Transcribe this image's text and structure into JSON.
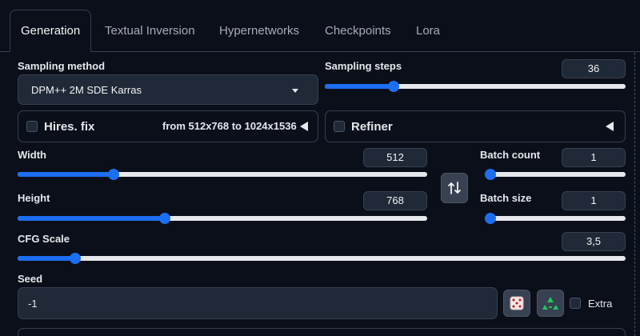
{
  "tabs": [
    {
      "label": "Generation",
      "active": true
    },
    {
      "label": "Textual Inversion",
      "active": false
    },
    {
      "label": "Hypernetworks",
      "active": false
    },
    {
      "label": "Checkpoints",
      "active": false
    },
    {
      "label": "Lora",
      "active": false
    }
  ],
  "sampling": {
    "method_label": "Sampling method",
    "method_value": "DPM++ 2M SDE Karras",
    "steps_label": "Sampling steps",
    "steps_value": "36",
    "steps_fraction": 0.23
  },
  "hires": {
    "label": "Hires. fix",
    "summary": "from 512x768  to 1024x1536"
  },
  "refiner": {
    "label": "Refiner"
  },
  "width": {
    "label": "Width",
    "value": "512",
    "fraction": 0.235
  },
  "height": {
    "label": "Height",
    "value": "768",
    "fraction": 0.36
  },
  "batch_count": {
    "label": "Batch count",
    "value": "1",
    "fraction": 0.0
  },
  "batch_size": {
    "label": "Batch size",
    "value": "1",
    "fraction": 0.0
  },
  "cfg": {
    "label": "CFG Scale",
    "value": "3,5",
    "fraction": 0.095
  },
  "seed": {
    "label": "Seed",
    "value": "-1",
    "extra_label": "Extra"
  },
  "icons": {
    "swap": "swap-arrows-icon",
    "dice": "dice-icon",
    "recycle": "recycle-icon",
    "caret": "caret-down-icon",
    "collapse": "triangle-left-icon"
  },
  "colors": {
    "accent": "#1c6ef2",
    "background": "#0b0f19",
    "panel": "#1f2937",
    "border": "#374151",
    "recycle": "#22c55e"
  }
}
